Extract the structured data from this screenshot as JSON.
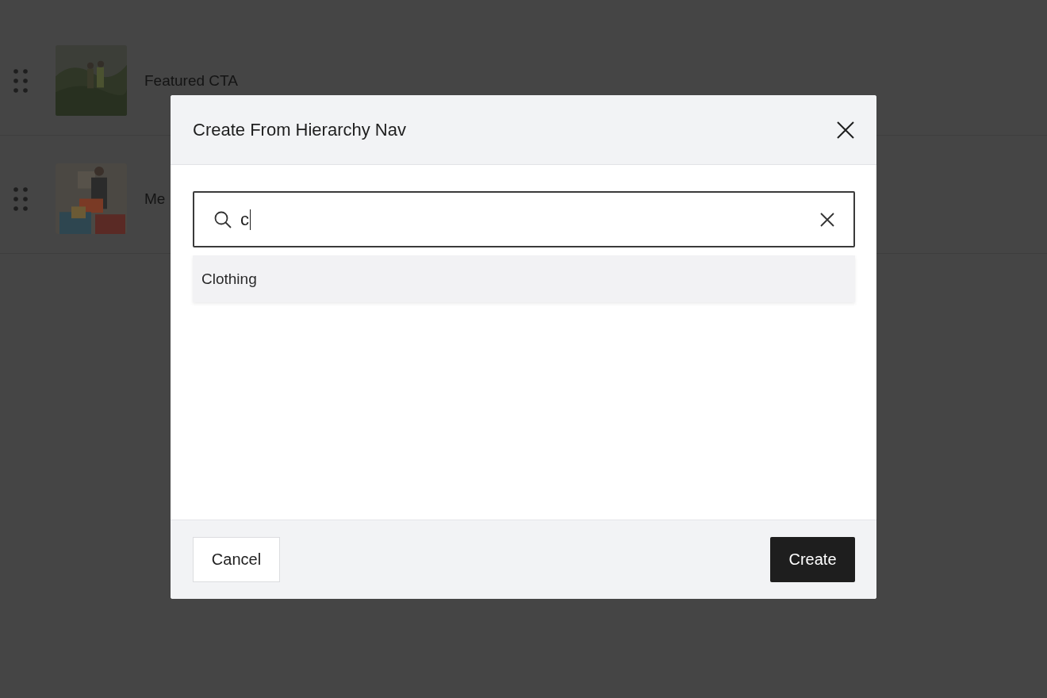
{
  "background_list": {
    "rows": [
      {
        "label": "Featured CTA"
      },
      {
        "label": "Me"
      }
    ]
  },
  "dialog": {
    "title": "Create From Hierarchy Nav",
    "search": {
      "value": "c"
    },
    "results": [
      {
        "label": "Clothing",
        "selected": true
      }
    ],
    "buttons": {
      "cancel": "Cancel",
      "create": "Create"
    }
  }
}
